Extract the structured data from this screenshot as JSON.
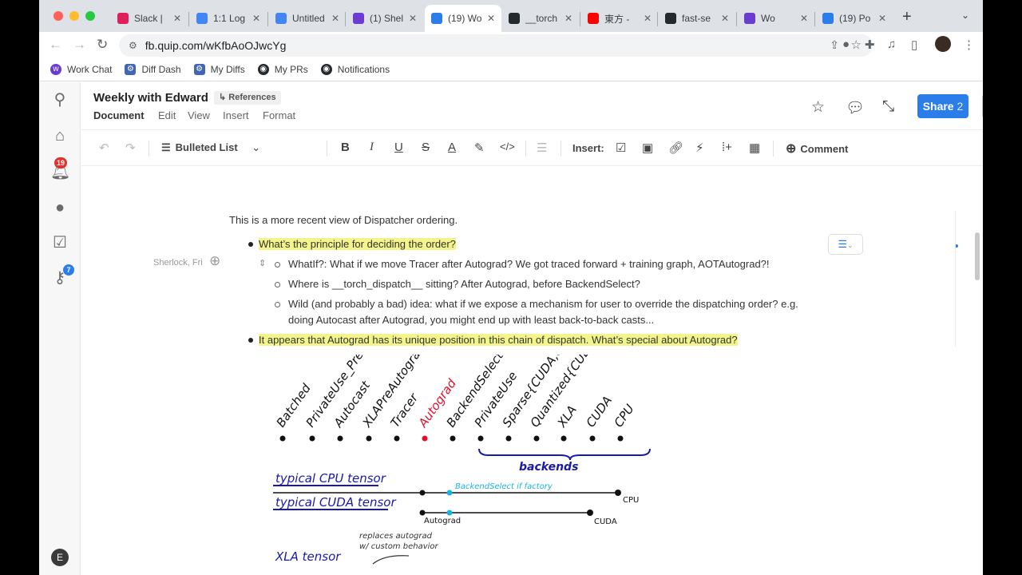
{
  "browser": {
    "tabs": [
      {
        "label": "Slack |",
        "color": "#e01e5a",
        "active": false
      },
      {
        "label": "1:1 Log",
        "color": "#4285f4",
        "active": false
      },
      {
        "label": "Untitled",
        "color": "#4285f4",
        "active": false
      },
      {
        "label": "(1) Shel",
        "color": "#6a3ccf",
        "active": false
      },
      {
        "label": "(19) Wo",
        "color": "#2b7de9",
        "active": true
      },
      {
        "label": "__torch",
        "color": "#24292e",
        "active": false
      },
      {
        "label": "東方 -",
        "color": "#ff0000",
        "active": false
      },
      {
        "label": "fast-se",
        "color": "#24292e",
        "active": false
      },
      {
        "label": "Wo",
        "color": "#6a3ccf",
        "active": false
      },
      {
        "label": "(19) Po",
        "color": "#2b7de9",
        "active": false
      }
    ],
    "url": "fb.quip.com/wKfbAoOJwcYg",
    "bookmarks": [
      "Work Chat",
      "Diff Dash",
      "My Diffs",
      "My PRs",
      "Notifications"
    ]
  },
  "rail": {
    "notifications_badge": "19",
    "keys_badge": "7",
    "avatar_letter": "E"
  },
  "doc_header": {
    "title": "Weekly with Edward",
    "references": "References",
    "menu": [
      "Document",
      "Edit",
      "View",
      "Insert",
      "Format"
    ],
    "share_label": "Share",
    "share_count": "2"
  },
  "format_toolbar": {
    "list_style": "Bulleted List",
    "insert_label": "Insert:",
    "comment_label": "Comment"
  },
  "content": {
    "intro": "This is a more recent view of Dispatcher ordering.",
    "comment_author": "Sherlock, Fri",
    "bullet1": "What’s the principle for deciding the order?",
    "sub1": "WhatIf?: What if we move Tracer after Autograd? We got traced forward + training graph, AOTAutograd?!",
    "sub2": "Where is __torch_dispatch__ sitting? After Autograd, before BackendSelect?",
    "sub3_line1": "Wild (and probably a bad) idea: what if we expose a mechanism for user to override the dispatching order? e.g.",
    "sub3_line2": "doing Autocast after Autograd, you might end up with least back-to-back casts...",
    "bullet2": "It appears that Autograd has its unique position in this chain of dispatch. What’s special about Autograd?"
  },
  "sketch": {
    "keys": [
      "Batched",
      "PrivateUse_PreAutograd",
      "Autocast",
      "XLAPreAutograd",
      "Tracer",
      "Autograd",
      "BackendSelect",
      "PrivateUse",
      "Sparse{CUDA,CPU}",
      "Quantized{CUDA,CPU}",
      "XLA",
      "CUDA",
      "CPU"
    ],
    "highlight_key": "Autograd",
    "backends_label": "backends",
    "row1_label": "typical CPU tensor",
    "row1_mid": "BackendSelect if factory",
    "row1_end": "CPU",
    "row2_label": "typical CUDA tensor",
    "row2_mid": "Autograd",
    "row2_end": "CUDA",
    "row3_label": "XLA tensor",
    "row3_note1": "replaces autograd",
    "row3_note2": "w/ custom behavior",
    "colors": {
      "ink": "#111111",
      "blue": "#1a1aa8",
      "cyan": "#18b4e0",
      "red": "#e0102a"
    }
  }
}
